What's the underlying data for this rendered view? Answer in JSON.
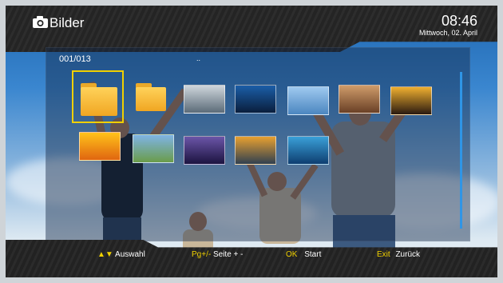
{
  "header": {
    "title": "Bilder",
    "time": "08:46",
    "date": "Mittwoch, 02. April"
  },
  "browser": {
    "counter": "001/013",
    "path": ".."
  },
  "items": [
    {
      "type": "folder",
      "name": "folder-icon"
    },
    {
      "type": "folder",
      "name": "folder-icon"
    },
    {
      "type": "image",
      "name": "thumbnail-winter-avenue",
      "colors": [
        "#cfd6dc",
        "#5b6b78"
      ]
    },
    {
      "type": "image",
      "name": "thumbnail-infinity-pool",
      "colors": [
        "#1b5ea8",
        "#0a1e3c"
      ]
    },
    {
      "type": "image",
      "name": "thumbnail-city-skyline",
      "colors": [
        "#9ec9ef",
        "#4b86c0"
      ]
    },
    {
      "type": "image",
      "name": "thumbnail-desert-cliffs",
      "colors": [
        "#cf9c6a",
        "#6a4026"
      ]
    },
    {
      "type": "image",
      "name": "thumbnail-sunset-sea",
      "colors": [
        "#f0b030",
        "#2a1a10"
      ]
    },
    {
      "type": "image",
      "name": "thumbnail-sunburst",
      "colors": [
        "#ffc21a",
        "#e06510"
      ]
    },
    {
      "type": "image",
      "name": "thumbnail-wind-turbines",
      "colors": [
        "#7fb4e6",
        "#6a9c4a"
      ]
    },
    {
      "type": "image",
      "name": "thumbnail-lightning",
      "colors": [
        "#6b55a8",
        "#1c1440"
      ]
    },
    {
      "type": "image",
      "name": "thumbnail-golden-sunset",
      "colors": [
        "#e8a030",
        "#304050"
      ]
    },
    {
      "type": "image",
      "name": "thumbnail-ocean-splash",
      "colors": [
        "#3aa0d8",
        "#0e3e70"
      ]
    }
  ],
  "footer": {
    "nav_arrows": "▲▼",
    "nav_label": "Auswahl",
    "page_key": "Pg+/-",
    "page_label": "Seite + -",
    "ok_key": "OK",
    "ok_label": "Start",
    "exit_key": "Exit",
    "exit_label": "Zurück"
  },
  "colors": {
    "accent_yellow": "#f0d000",
    "scrollbar_blue": "#2f95e6"
  }
}
